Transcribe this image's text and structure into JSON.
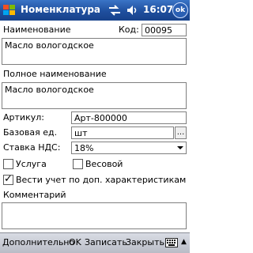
{
  "titlebar": {
    "title": "Номенклатура",
    "time": "16:07",
    "ok_label": "ok"
  },
  "form": {
    "name_label": "Наименование",
    "code_label": "Код:",
    "code_value": "00095",
    "name_value": "Масло вологодское",
    "fullname_label": "Полное наименование",
    "fullname_value": "Масло вологодское",
    "article_label": "Артикул:",
    "article_value": "Арт-800000",
    "unit_label": "Базовая ед.",
    "unit_value": "шт",
    "unit_button": "...",
    "vat_label": "Ставка НДС:",
    "vat_value": "18%",
    "service_label": "Услуга",
    "service_checked": false,
    "weight_label": "Весовой",
    "weight_checked": false,
    "track_label": "Вести учет по доп. характеристикам",
    "track_checked": true,
    "comment_label": "Комментарий",
    "comment_value": ""
  },
  "toolbar": {
    "more_label": "Дополнительно",
    "ok_label": "OK",
    "save_label": "Записать",
    "close_label": "Закрыть",
    "up_arrow": "▲"
  }
}
